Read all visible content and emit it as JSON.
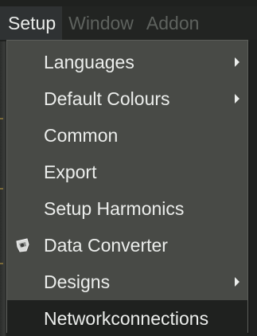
{
  "menubar": {
    "items": [
      {
        "label": "Setup",
        "active": true
      },
      {
        "label": "Window",
        "active": false
      },
      {
        "label": "Addon",
        "active": false
      }
    ]
  },
  "dropdown": {
    "items": [
      {
        "label": "Languages",
        "has_submenu": true,
        "icon": null
      },
      {
        "label": "Default Colours",
        "has_submenu": true,
        "icon": null
      },
      {
        "label": "Common",
        "has_submenu": false,
        "icon": null
      },
      {
        "label": "Export",
        "has_submenu": false,
        "icon": null
      },
      {
        "label": "Setup Harmonics",
        "has_submenu": false,
        "icon": null
      },
      {
        "label": "Data Converter",
        "has_submenu": false,
        "icon": "data-converter-icon"
      },
      {
        "label": "Designs",
        "has_submenu": true,
        "icon": null
      },
      {
        "label": "Networkconnections",
        "has_submenu": false,
        "icon": null,
        "selected": true
      }
    ]
  },
  "colors": {
    "menu_background": "#484a46",
    "menubar_background": "#222422",
    "active_menubar_item": "#2f3233",
    "selected_item": "#1f211f",
    "text": "#eceeec",
    "disabled_text": "#5e625e"
  }
}
